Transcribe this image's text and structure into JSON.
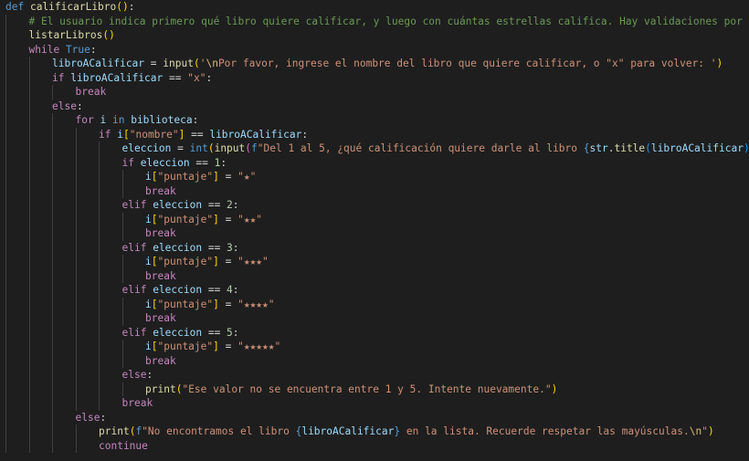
{
  "colors": {
    "background": "#1e1e1e",
    "keyword": "#569cd6",
    "control": "#c586c0",
    "function": "#dcdcaa",
    "variable": "#9cdcfe",
    "string": "#ce9178",
    "number": "#b5cea8",
    "comment": "#6a9955",
    "text": "#d4d4d4",
    "bracket_1": "#ffd700",
    "bracket_2": "#da70d6",
    "bracket_3": "#179fff",
    "escape": "#d7ba7d",
    "indent_guide": "#404040"
  },
  "lines": [
    {
      "indent": 0,
      "tokens": [
        [
          "kw",
          "def"
        ],
        [
          "pun",
          " "
        ],
        [
          "fn",
          "calificarLibro"
        ],
        [
          "br",
          "()"
        ],
        [
          "pun",
          ":"
        ]
      ]
    },
    {
      "indent": 1,
      "tokens": [
        [
          "com",
          "# El usuario indica primero qué libro quiere calificar, y luego con cuántas estrellas califica. Hay validaciones por números f"
        ]
      ]
    },
    {
      "indent": 1,
      "tokens": [
        [
          "fn",
          "listarLibros"
        ],
        [
          "br",
          "()"
        ]
      ]
    },
    {
      "indent": 1,
      "tokens": [
        [
          "ctl",
          "while"
        ],
        [
          "pun",
          " "
        ],
        [
          "kw",
          "True"
        ],
        [
          "pun",
          ":"
        ]
      ]
    },
    {
      "indent": 2,
      "tokens": [
        [
          "var",
          "libroACalificar"
        ],
        [
          "pun",
          " = "
        ],
        [
          "fn",
          "input"
        ],
        [
          "br",
          "("
        ],
        [
          "str",
          "'"
        ],
        [
          "esc",
          "\\n"
        ],
        [
          "str",
          "Por favor, ingrese el nombre del libro que quiere calificar, o \"x\" para volver: '"
        ],
        [
          "br",
          ")"
        ]
      ]
    },
    {
      "indent": 2,
      "tokens": [
        [
          "ctl",
          "if"
        ],
        [
          "pun",
          " "
        ],
        [
          "var",
          "libroACalificar"
        ],
        [
          "pun",
          " == "
        ],
        [
          "str",
          "\"x\""
        ],
        [
          "pun",
          ":"
        ]
      ]
    },
    {
      "indent": 3,
      "tokens": [
        [
          "ctl",
          "break"
        ]
      ]
    },
    {
      "indent": 2,
      "tokens": [
        [
          "ctl",
          "else"
        ],
        [
          "pun",
          ":"
        ]
      ]
    },
    {
      "indent": 3,
      "tokens": [
        [
          "ctl",
          "for"
        ],
        [
          "pun",
          " "
        ],
        [
          "var",
          "i"
        ],
        [
          "pun",
          " "
        ],
        [
          "kw",
          "in"
        ],
        [
          "pun",
          " "
        ],
        [
          "var",
          "biblioteca"
        ],
        [
          "pun",
          ":"
        ]
      ]
    },
    {
      "indent": 4,
      "tokens": [
        [
          "ctl",
          "if"
        ],
        [
          "pun",
          " "
        ],
        [
          "var",
          "i"
        ],
        [
          "br",
          "["
        ],
        [
          "str",
          "\"nombre\""
        ],
        [
          "br",
          "]"
        ],
        [
          "pun",
          " == "
        ],
        [
          "var",
          "libroACalificar"
        ],
        [
          "pun",
          ":"
        ]
      ]
    },
    {
      "indent": 5,
      "tokens": [
        [
          "var",
          "eleccion"
        ],
        [
          "pun",
          " = "
        ],
        [
          "kw",
          "int"
        ],
        [
          "br",
          "("
        ],
        [
          "fn",
          "input"
        ],
        [
          "br2",
          "("
        ],
        [
          "kw",
          "f"
        ],
        [
          "str",
          "\"Del 1 al 5, ¿qué calificación quiere darle al libro "
        ],
        [
          "kw",
          "{"
        ],
        [
          "var",
          "str"
        ],
        [
          "pun",
          "."
        ],
        [
          "fn",
          "title"
        ],
        [
          "br3",
          "("
        ],
        [
          "var",
          "libroACalificar"
        ],
        [
          "br3",
          ")"
        ],
        [
          "kw",
          "}"
        ],
        [
          "str",
          "?: \""
        ],
        [
          "br2",
          ")"
        ],
        [
          "br",
          ")"
        ]
      ]
    },
    {
      "indent": 5,
      "tokens": [
        [
          "ctl",
          "if"
        ],
        [
          "pun",
          " "
        ],
        [
          "var",
          "eleccion"
        ],
        [
          "pun",
          " == "
        ],
        [
          "num",
          "1"
        ],
        [
          "pun",
          ":"
        ]
      ]
    },
    {
      "indent": 6,
      "tokens": [
        [
          "var",
          "i"
        ],
        [
          "br",
          "["
        ],
        [
          "str",
          "\"puntaje\""
        ],
        [
          "br",
          "]"
        ],
        [
          "pun",
          " = "
        ],
        [
          "str",
          "\"★\""
        ]
      ]
    },
    {
      "indent": 6,
      "tokens": [
        [
          "ctl",
          "break"
        ]
      ]
    },
    {
      "indent": 5,
      "tokens": [
        [
          "ctl",
          "elif"
        ],
        [
          "pun",
          " "
        ],
        [
          "var",
          "eleccion"
        ],
        [
          "pun",
          " == "
        ],
        [
          "num",
          "2"
        ],
        [
          "pun",
          ":"
        ]
      ]
    },
    {
      "indent": 6,
      "tokens": [
        [
          "var",
          "i"
        ],
        [
          "br",
          "["
        ],
        [
          "str",
          "\"puntaje\""
        ],
        [
          "br",
          "]"
        ],
        [
          "pun",
          " = "
        ],
        [
          "str",
          "\"★★\""
        ]
      ]
    },
    {
      "indent": 6,
      "tokens": [
        [
          "ctl",
          "break"
        ]
      ]
    },
    {
      "indent": 5,
      "tokens": [
        [
          "ctl",
          "elif"
        ],
        [
          "pun",
          " "
        ],
        [
          "var",
          "eleccion"
        ],
        [
          "pun",
          " == "
        ],
        [
          "num",
          "3"
        ],
        [
          "pun",
          ":"
        ]
      ]
    },
    {
      "indent": 6,
      "tokens": [
        [
          "var",
          "i"
        ],
        [
          "br",
          "["
        ],
        [
          "str",
          "\"puntaje\""
        ],
        [
          "br",
          "]"
        ],
        [
          "pun",
          " = "
        ],
        [
          "str",
          "\"★★★\""
        ]
      ]
    },
    {
      "indent": 6,
      "tokens": [
        [
          "ctl",
          "break"
        ]
      ]
    },
    {
      "indent": 5,
      "tokens": [
        [
          "ctl",
          "elif"
        ],
        [
          "pun",
          " "
        ],
        [
          "var",
          "eleccion"
        ],
        [
          "pun",
          " == "
        ],
        [
          "num",
          "4"
        ],
        [
          "pun",
          ":"
        ]
      ]
    },
    {
      "indent": 6,
      "tokens": [
        [
          "var",
          "i"
        ],
        [
          "br",
          "["
        ],
        [
          "str",
          "\"puntaje\""
        ],
        [
          "br",
          "]"
        ],
        [
          "pun",
          " = "
        ],
        [
          "str",
          "\"★★★★\""
        ]
      ]
    },
    {
      "indent": 6,
      "tokens": [
        [
          "ctl",
          "break"
        ]
      ]
    },
    {
      "indent": 5,
      "tokens": [
        [
          "ctl",
          "elif"
        ],
        [
          "pun",
          " "
        ],
        [
          "var",
          "eleccion"
        ],
        [
          "pun",
          " == "
        ],
        [
          "num",
          "5"
        ],
        [
          "pun",
          ":"
        ]
      ]
    },
    {
      "indent": 6,
      "tokens": [
        [
          "var",
          "i"
        ],
        [
          "br",
          "["
        ],
        [
          "str",
          "\"puntaje\""
        ],
        [
          "br",
          "]"
        ],
        [
          "pun",
          " = "
        ],
        [
          "str",
          "\"★★★★★\""
        ]
      ]
    },
    {
      "indent": 6,
      "tokens": [
        [
          "ctl",
          "break"
        ]
      ]
    },
    {
      "indent": 5,
      "tokens": [
        [
          "ctl",
          "else"
        ],
        [
          "pun",
          ":"
        ]
      ]
    },
    {
      "indent": 6,
      "tokens": [
        [
          "fn",
          "print"
        ],
        [
          "br",
          "("
        ],
        [
          "str",
          "\"Ese valor no se encuentra entre 1 y 5. Intente nuevamente.\""
        ],
        [
          "br",
          ")"
        ]
      ]
    },
    {
      "indent": 5,
      "tokens": [
        [
          "ctl",
          "break"
        ]
      ]
    },
    {
      "indent": 3,
      "tokens": [
        [
          "ctl",
          "else"
        ],
        [
          "pun",
          ":"
        ]
      ]
    },
    {
      "indent": 4,
      "tokens": [
        [
          "fn",
          "print"
        ],
        [
          "br",
          "("
        ],
        [
          "kw",
          "f"
        ],
        [
          "str",
          "\"No encontramos el libro "
        ],
        [
          "kw",
          "{"
        ],
        [
          "var",
          "libroACalificar"
        ],
        [
          "kw",
          "}"
        ],
        [
          "str",
          " en la lista. Recuerde respetar las mayúsculas."
        ],
        [
          "esc",
          "\\n"
        ],
        [
          "str",
          "\""
        ],
        [
          "br",
          ")"
        ]
      ]
    },
    {
      "indent": 4,
      "tokens": [
        [
          "ctl",
          "continue"
        ]
      ]
    }
  ]
}
